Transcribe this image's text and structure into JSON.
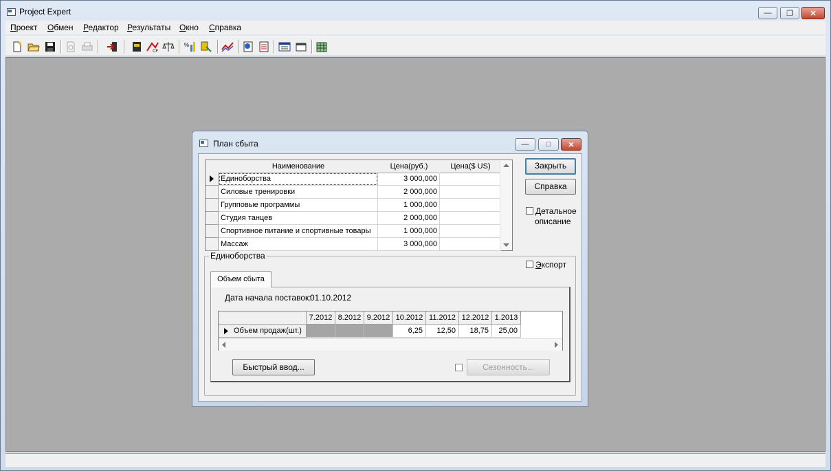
{
  "app": {
    "title": "Project Expert",
    "menu": [
      "Проект",
      "Обмен",
      "Редактор",
      "Результаты",
      "Окно",
      "Справка"
    ]
  },
  "dialog": {
    "title": "План сбыта",
    "table": {
      "headers": [
        "Наименование",
        "Цена(руб.)",
        "Цена($ US)"
      ],
      "rows": [
        {
          "name": "Единоборства",
          "price_rub": "3 000,000",
          "price_usd": ""
        },
        {
          "name": "Силовые тренировки",
          "price_rub": "2 000,000",
          "price_usd": ""
        },
        {
          "name": "Групповые программы",
          "price_rub": "1 000,000",
          "price_usd": ""
        },
        {
          "name": "Студия танцев",
          "price_rub": "2 000,000",
          "price_usd": ""
        },
        {
          "name": "Спортивное питание и спортивные товары",
          "price_rub": "1 000,000",
          "price_usd": ""
        },
        {
          "name": "Массаж",
          "price_rub": "3 000,000",
          "price_usd": ""
        }
      ]
    },
    "buttons": {
      "close": "Закрыть",
      "help": "Справка",
      "quick_input": "Быстрый ввод...",
      "seasonality": "Сезонность..."
    },
    "detail_checkbox": {
      "line1": "Детальное",
      "line2": "описание"
    },
    "group_title": "Единоборства",
    "export_label": "Экспорт",
    "tab_label": "Объем сбыта",
    "start_date_label": "Дата начала поставок:",
    "start_date_value": "01.10.2012",
    "period_grid": {
      "row_label": "Объем продаж(шт.)",
      "periods": [
        "7.2012",
        "8.2012",
        "9.2012",
        "10.2012",
        "11.2012",
        "12.2012",
        "1.2013"
      ],
      "values": [
        "",
        "",
        "",
        "6,25",
        "12,50",
        "18,75",
        "25,00"
      ]
    }
  }
}
